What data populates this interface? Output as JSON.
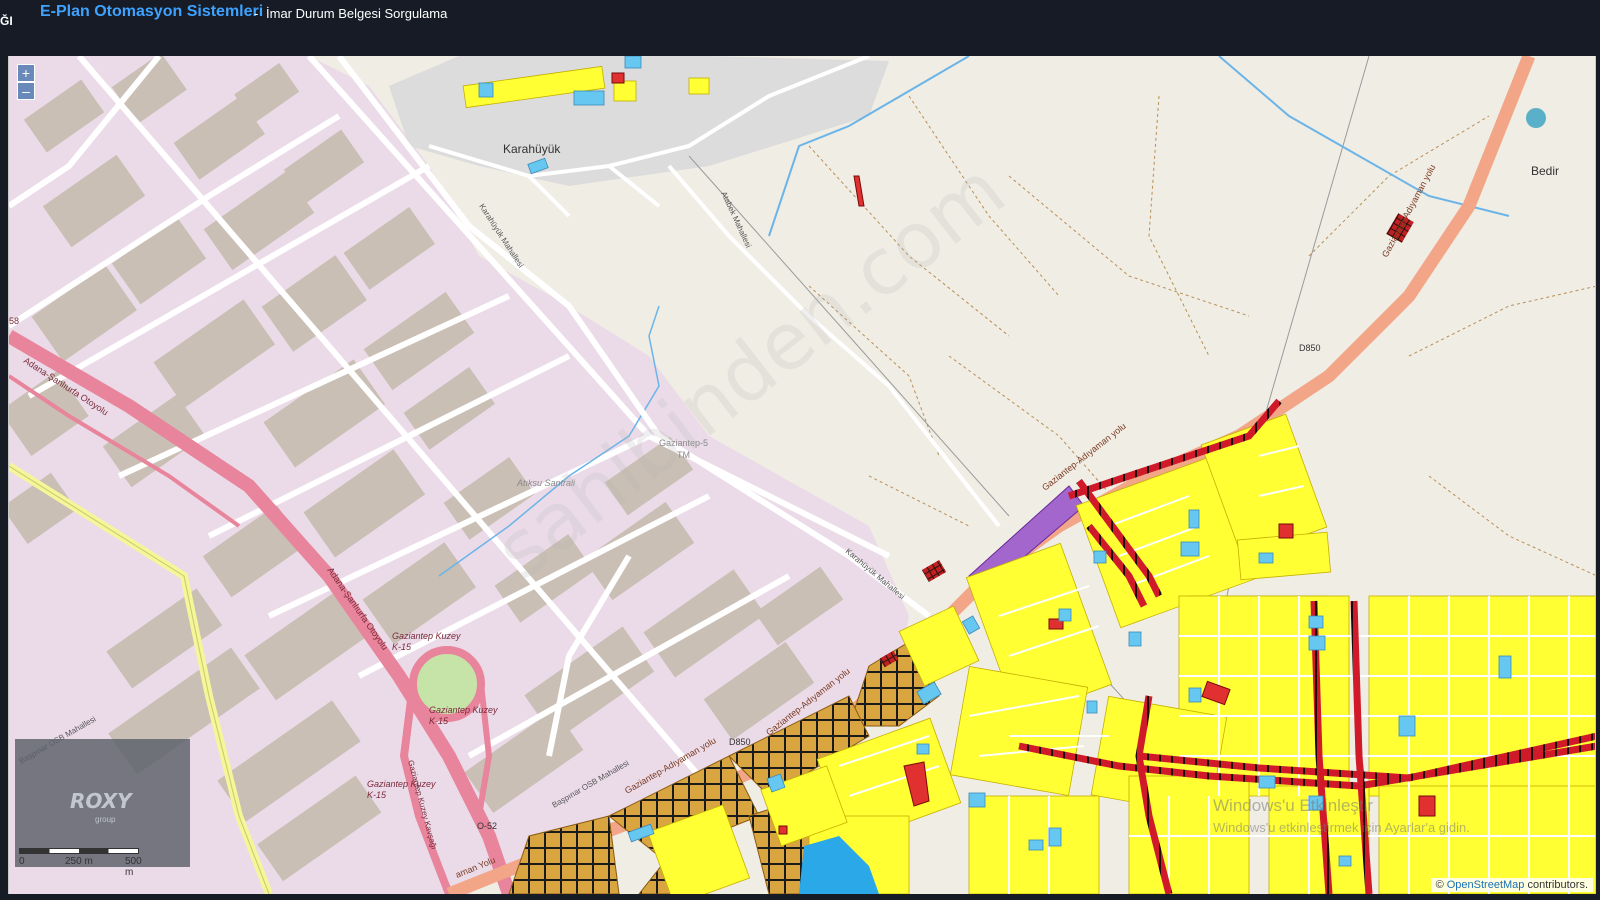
{
  "header": {
    "cut_label": "ĞI",
    "brand": "E-Plan Otomasyon Sistemleri",
    "separator": "-",
    "subtitle": "İmar Durum Belgesi Sorgulama"
  },
  "map": {
    "zoom_in": "+",
    "zoom_out": "–",
    "labels": {
      "karahuyuk": "Karahüyük",
      "bedir": "Bedir",
      "karahuyuk_mah_1": "Karahüyük Mahallesi",
      "karahuyuk_mah_2": "Karahüyük Mahallesi",
      "atabek_mah": "Atabek Mahallesi",
      "otoyolu_1": "Adana-Şanlıurfa Otoyolu",
      "otoyolu_2": "Adana-Şanlıurfa Otoyolu",
      "road_58": "58",
      "adiyaman_yolu_1": "Gaziantep-Adıyaman yolu",
      "adiyaman_yolu_2": "Gaziantep-Adıyaman yolu",
      "adiyaman_yolu_3": "Gaziantep-Adıyaman yolu",
      "adiyaman_yolu_4": "Gaziantep-Adıyaman yolu",
      "adiyaman_yolu_5": "Gaziantep-Adıyaman yolu",
      "adiyaman_yolu_cut": "aman Yolu",
      "d850_1": "D850",
      "d850_2": "D850",
      "o52": "O-52",
      "gaziantep_5_1": "Gaziantep-5",
      "gaziantep_5_2": "TM",
      "atiksu": "Atıksu Santrali",
      "kuzey_k15_1": "Gaziantep Kuzey",
      "kuzey_k15_1b": "K-15",
      "kuzey_k15_2": "Gaziantep Kuzey",
      "kuzey_k15_2b": "K-15",
      "kuzey_kavsagi": "Gaziantep Kuzey Kavşağı",
      "kuzey_k15_3": "Gaziantep Kuzey",
      "kuzey_k15_3b": "K-15",
      "baspinar_osb_1": "Başpınar OSB Mahallesi",
      "baspinar_osb_2": "Başpınar OSB Mahallesi"
    },
    "scale": {
      "label_0": "0",
      "label_250": "250 m",
      "label_500": "500 m"
    },
    "watermark_logo": {
      "name": "ROXY",
      "sub": "group"
    },
    "site_watermark": "sahibinden.com",
    "attribution": {
      "prefix": "©",
      "link": "OpenStreetMap",
      "suffix": "contributors."
    },
    "windows_activation": {
      "line1": "Windows'u Etkinleştir",
      "line2": "Windows'u etkinleştirmek için Ayarlar'a gidin."
    },
    "colors": {
      "base": "#f0ede5",
      "industrial": "#ebdbe8",
      "building": "#c9bfb4",
      "residential_parcel": "#ffff33",
      "commercial_parcel": "#e03030",
      "public_parcel": "#66c8f0",
      "purple_parcel": "#a366cc",
      "hatched_parcel": "#d9a540",
      "highway": "#e8849b",
      "primary_road": "#f2a687",
      "motorway_link": "#f5f599",
      "water": "#2aa8e8"
    }
  }
}
